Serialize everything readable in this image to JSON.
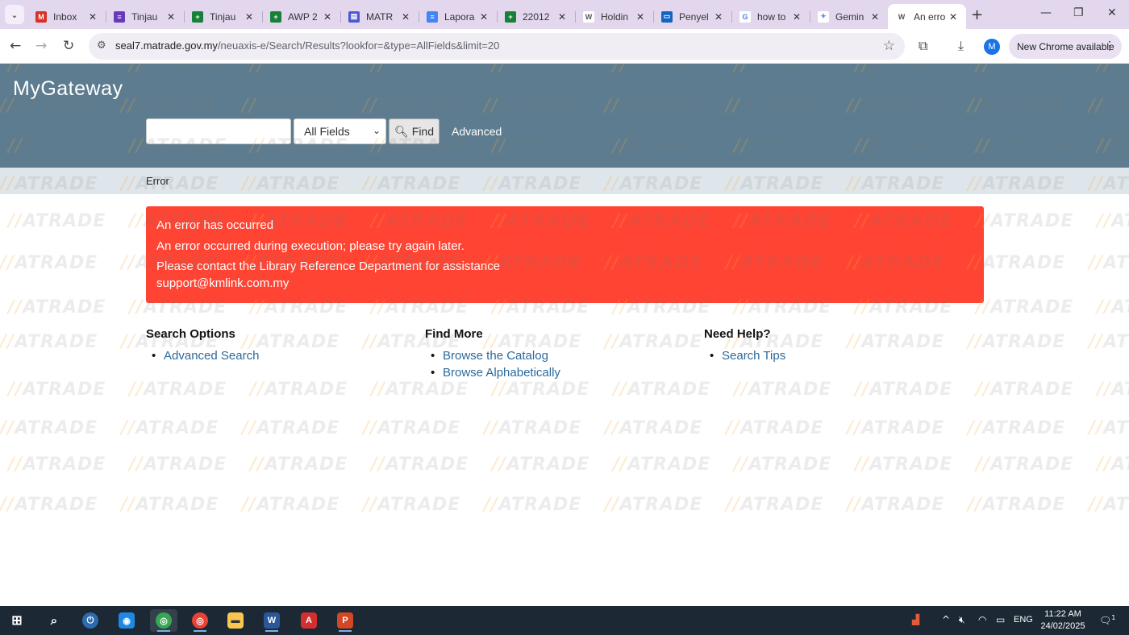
{
  "browser": {
    "tabs": [
      {
        "title": "Inbox",
        "favicon": "gmail-icon",
        "color": "#d93025",
        "glyph": "M"
      },
      {
        "title": "Tinjau",
        "favicon": "forms-icon",
        "color": "#673ab7",
        "glyph": "≡"
      },
      {
        "title": "Tinjau",
        "favicon": "sheets-icon",
        "color": "#188038",
        "glyph": "+"
      },
      {
        "title": "AWP 2",
        "favicon": "sheets-icon",
        "color": "#188038",
        "glyph": "+"
      },
      {
        "title": "MATR",
        "favicon": "print-icon",
        "color": "#4c5bd4",
        "glyph": "▤"
      },
      {
        "title": "Lapora",
        "favicon": "docs-icon",
        "color": "#4285f4",
        "glyph": "≡"
      },
      {
        "title": "22012",
        "favicon": "sheets-icon",
        "color": "#188038",
        "glyph": "+"
      },
      {
        "title": "Holdin",
        "favicon": "w-icon",
        "color": "#ffffff",
        "glyph": "W"
      },
      {
        "title": "Penyel",
        "favicon": "window-icon",
        "color": "#1565c0",
        "glyph": "▭"
      },
      {
        "title": "how to",
        "favicon": "google-icon",
        "color": "#ffffff",
        "glyph": "G"
      },
      {
        "title": "Gemin",
        "favicon": "gemini-icon",
        "color": "#ffffff",
        "glyph": "✦"
      },
      {
        "title": "An erro",
        "favicon": "w-icon",
        "color": "#ffffff",
        "glyph": "W",
        "active": true
      }
    ],
    "url_host": "seal7.matrade.gov.my",
    "url_path": "/neuaxis-e/Search/Results?lookfor=&type=AllFields&limit=20",
    "profile_initial": "M",
    "update_label": "New Chrome available"
  },
  "site": {
    "brand": "MyGateway",
    "search": {
      "value": "",
      "placeholder": ""
    },
    "field_select": {
      "selected": "All Fields"
    },
    "find_label": "Find",
    "advanced_label": "Advanced",
    "breadcrumb": "Error",
    "watermark_text": "MATRADE"
  },
  "alert": {
    "heading": "An error has occurred",
    "message": "An error occurred during execution; please try again later.",
    "contact": "Please contact the Library Reference Department for assistance",
    "email": "support@kmlink.com.my",
    "color": "#ff4433"
  },
  "footer_columns": [
    {
      "heading": "Search Options",
      "links": [
        "Advanced Search"
      ]
    },
    {
      "heading": "Find More",
      "links": [
        "Browse the Catalog",
        "Browse Alphabetically"
      ]
    },
    {
      "heading": "Need Help?",
      "links": [
        "Search Tips"
      ]
    }
  ],
  "taskbar": {
    "language": "ENG",
    "time": "11:22 AM",
    "date": "24/02/2025",
    "notification_count": "1"
  }
}
